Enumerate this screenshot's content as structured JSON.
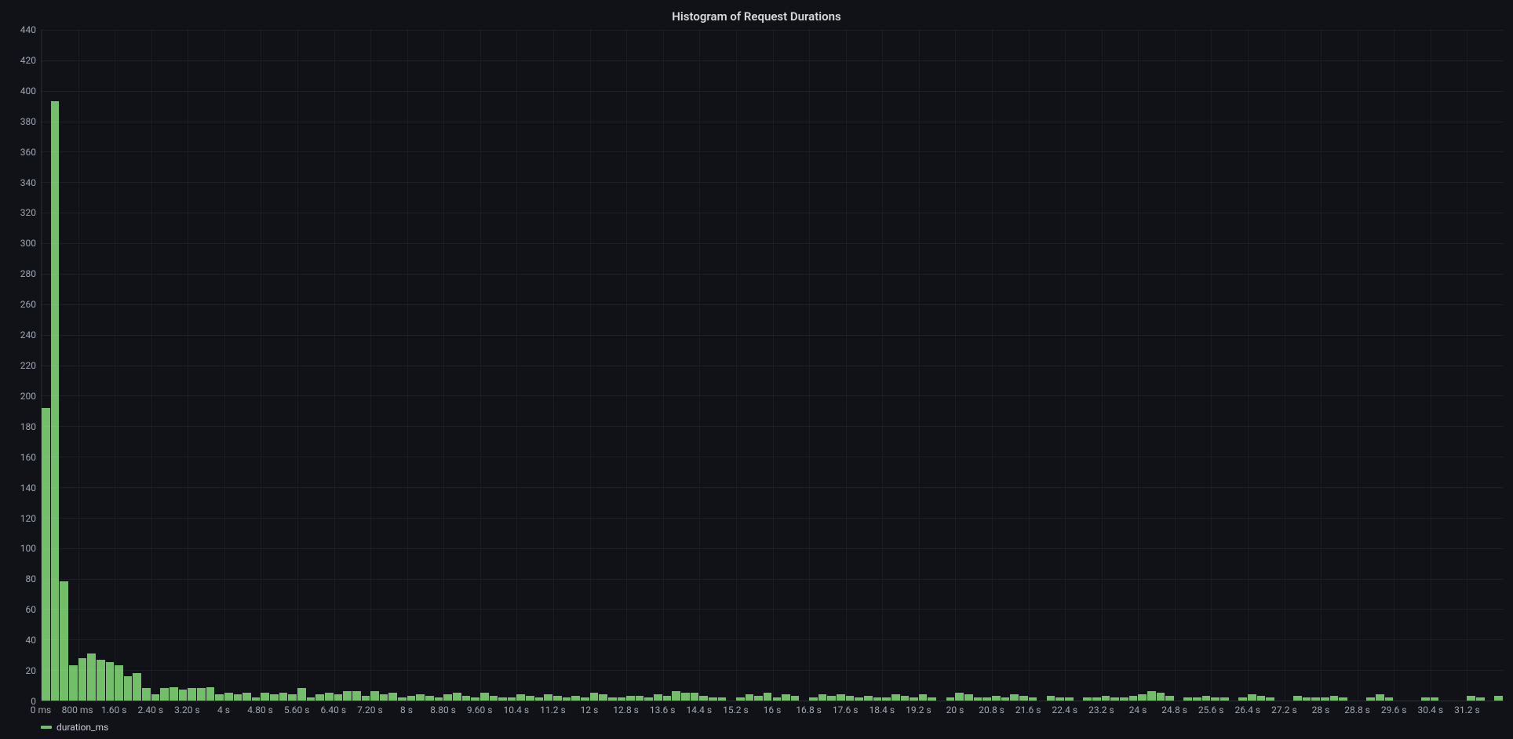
{
  "title": "Histogram of Request Durations",
  "legend": {
    "series_name": "duration_ms"
  },
  "colors": {
    "bar": "#73bf69",
    "bg": "#111217",
    "text": "#9fa7b3"
  },
  "chart_data": {
    "type": "bar",
    "title": "Histogram of Request Durations",
    "xlabel": "",
    "ylabel": "",
    "ylim": [
      0,
      440
    ],
    "y_ticks": [
      0,
      20,
      40,
      60,
      80,
      100,
      120,
      140,
      160,
      180,
      200,
      220,
      240,
      260,
      280,
      300,
      320,
      340,
      360,
      380,
      400,
      420,
      440
    ],
    "x_tick_labels": [
      "0 ms",
      "800 ms",
      "1.60 s",
      "2.40 s",
      "3.20 s",
      "4 s",
      "4.80 s",
      "5.60 s",
      "6.40 s",
      "7.20 s",
      "8 s",
      "8.80 s",
      "9.60 s",
      "10.4 s",
      "11.2 s",
      "12 s",
      "12.8 s",
      "13.6 s",
      "14.4 s",
      "15.2 s",
      "16 s",
      "16.8 s",
      "17.6 s",
      "18.4 s",
      "19.2 s",
      "20 s",
      "20.8 s",
      "21.6 s",
      "22.4 s",
      "23.2 s",
      "24 s",
      "24.8 s",
      "25.6 s",
      "26.4 s",
      "27.2 s",
      "28 s",
      "28.8 s",
      "29.6 s",
      "30.4 s",
      "31.2 s"
    ],
    "x_tick_positions_bin_index": [
      0,
      4,
      8,
      12,
      16,
      20,
      24,
      28,
      32,
      36,
      40,
      44,
      48,
      52,
      56,
      60,
      64,
      68,
      72,
      76,
      80,
      84,
      88,
      92,
      96,
      100,
      104,
      108,
      112,
      116,
      120,
      124,
      128,
      132,
      136,
      140,
      144,
      148,
      152,
      156
    ],
    "bin_width_ms": 200,
    "num_bins": 160,
    "series": [
      {
        "name": "duration_ms",
        "values": [
          192,
          393,
          78,
          23,
          28,
          31,
          27,
          25,
          23,
          16,
          18,
          8,
          4,
          8,
          9,
          7,
          8,
          8,
          9,
          4,
          5,
          4,
          5,
          2,
          5,
          4,
          5,
          4,
          8,
          2,
          4,
          5,
          4,
          6,
          6,
          3,
          6,
          4,
          5,
          2,
          3,
          4,
          3,
          2,
          4,
          5,
          3,
          2,
          5,
          3,
          2,
          2,
          4,
          3,
          2,
          4,
          3,
          2,
          3,
          2,
          5,
          4,
          2,
          2,
          3,
          3,
          2,
          4,
          3,
          6,
          5,
          5,
          3,
          2,
          2,
          0,
          2,
          4,
          3,
          5,
          2,
          4,
          3,
          0,
          2,
          4,
          3,
          4,
          3,
          2,
          3,
          2,
          2,
          4,
          3,
          2,
          4,
          2,
          0,
          2,
          5,
          4,
          2,
          2,
          3,
          2,
          4,
          3,
          2,
          0,
          3,
          2,
          2,
          0,
          2,
          2,
          3,
          2,
          2,
          3,
          4,
          6,
          5,
          3,
          0,
          2,
          2,
          3,
          2,
          2,
          0,
          2,
          4,
          3,
          2,
          0,
          0,
          3,
          2,
          2,
          2,
          3,
          2,
          0,
          0,
          2,
          4,
          2,
          0,
          0,
          0,
          2,
          2,
          0,
          0,
          0,
          3,
          2,
          0,
          3
        ]
      }
    ]
  }
}
